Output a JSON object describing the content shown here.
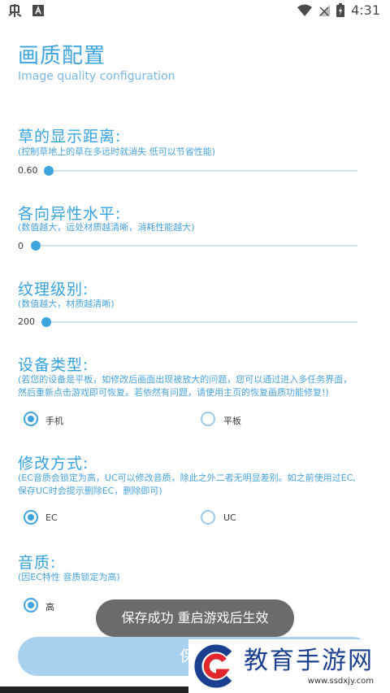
{
  "statusbar": {
    "time": "4:31"
  },
  "header": {
    "title": "画质配置",
    "subtitle": "Image quality configuration"
  },
  "sections": {
    "grass": {
      "title": "草的显示距离:",
      "desc": "(控制草地上的草在多远时就消失 低可以节省性能)",
      "value": "0.60",
      "slider_fraction": 0.0
    },
    "aniso": {
      "title": "各向异性水平:",
      "desc": "(数值越大，远处材质越清晰，消耗性能越大)",
      "value": "0",
      "slider_fraction": 0.0
    },
    "texture": {
      "title": "纹理级别:",
      "desc": "(数值越大，材质越清晰)",
      "value": "200",
      "slider_fraction": 0.0
    },
    "device": {
      "title": "设备类型:",
      "desc_line1": "(若您的设备是平板，如修改后画面出现被放大的问题，您可以通过进入多任务界面，",
      "desc_line2": "然后重新点击游戏即可恢复。若依然有问题，请使用主页的恢复画质功能修复!)",
      "options": [
        "手机",
        "平板"
      ],
      "selected": "手机"
    },
    "mode": {
      "title": "修改方式:",
      "desc_line1": "(EC音质会锁定为高，UC可以修改音质，除此之外二者无明显差别。如之前使用过EC,",
      "desc_line2": "保存UC时会提示删除EC，删除即可)",
      "options": [
        "EC",
        "UC"
      ],
      "selected": "EC"
    },
    "audio": {
      "title": "音质:",
      "desc": "(因EC特性 音质锁定为高)",
      "options": [
        "高"
      ],
      "selected": "高"
    }
  },
  "save_button": {
    "label": "保存"
  },
  "toast": {
    "text": "保存成功 重启游戏后生效"
  },
  "watermark": {
    "text": "教育手游网",
    "url": "www.ssdxjy.com"
  },
  "colors": {
    "accent": "#3fa4de",
    "button": "#a7d1ef",
    "toast": "#6b6b6b"
  }
}
